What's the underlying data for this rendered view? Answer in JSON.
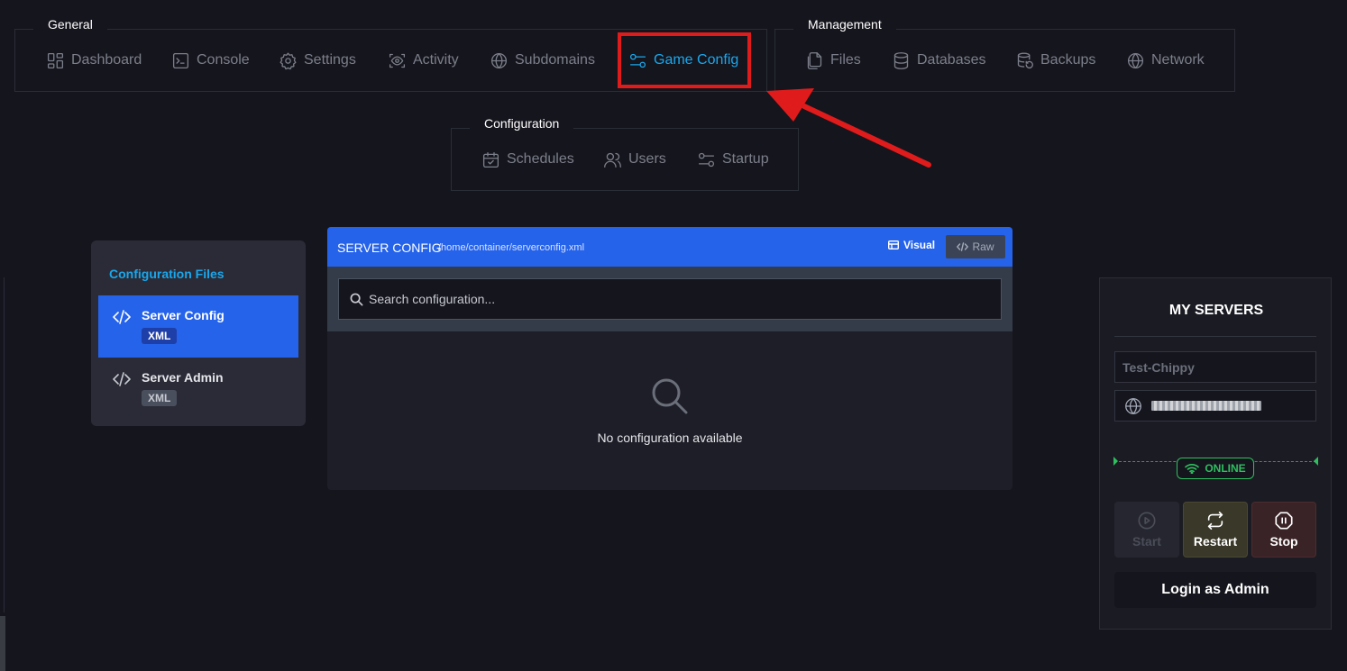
{
  "nav": {
    "general": {
      "label": "General",
      "items": [
        {
          "label": "Dashboard",
          "icon": "dashboard-icon"
        },
        {
          "label": "Console",
          "icon": "terminal-icon"
        },
        {
          "label": "Settings",
          "icon": "gear-icon"
        },
        {
          "label": "Activity",
          "icon": "eye-icon"
        },
        {
          "label": "Subdomains",
          "icon": "globe-icon"
        },
        {
          "label": "Game Config",
          "icon": "sliders-icon",
          "active": true
        }
      ]
    },
    "management": {
      "label": "Management",
      "items": [
        {
          "label": "Files",
          "icon": "files-icon"
        },
        {
          "label": "Databases",
          "icon": "database-icon"
        },
        {
          "label": "Backups",
          "icon": "backup-icon"
        },
        {
          "label": "Network",
          "icon": "globe-icon"
        }
      ]
    },
    "configuration": {
      "label": "Configuration",
      "items": [
        {
          "label": "Schedules",
          "icon": "calendar-icon"
        },
        {
          "label": "Users",
          "icon": "users-icon"
        },
        {
          "label": "Startup",
          "icon": "sliders-icon"
        }
      ]
    }
  },
  "config_files": {
    "title": "Configuration Files",
    "items": [
      {
        "name": "Server Config",
        "badge": "XML",
        "active": true
      },
      {
        "name": "Server Admin",
        "badge": "XML",
        "active": false
      }
    ]
  },
  "editor": {
    "title": "SERVER CONFIG",
    "path": "/home/container/serverconfig.xml",
    "visual_label": "Visual",
    "raw_label": "Raw",
    "search_placeholder": "Search configuration...",
    "empty_text": "No configuration available"
  },
  "servers": {
    "title": "MY SERVERS",
    "server_name": "Test-Chippy",
    "status": "ONLINE",
    "start_label": "Start",
    "restart_label": "Restart",
    "stop_label": "Stop",
    "login_label": "Login as Admin"
  },
  "colors": {
    "background": "#15151d",
    "accent": "#1aa7ec",
    "primary": "#2563eb",
    "online": "#2fbf5f",
    "annotation": "#e01b1b"
  }
}
